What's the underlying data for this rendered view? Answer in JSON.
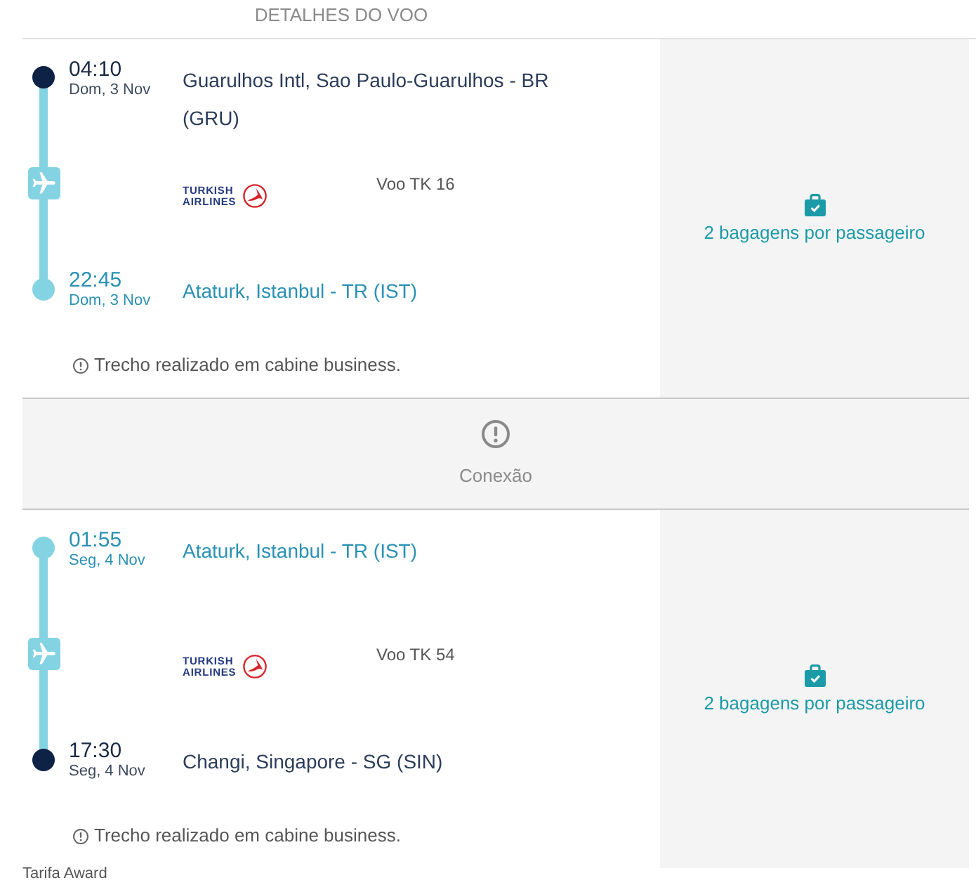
{
  "header": {
    "title": "DETALHES DO VOO"
  },
  "itinerary": [
    {
      "kind": "segment",
      "departure": {
        "time": "04:10",
        "date": "Dom, 3 Nov",
        "location": "Guarulhos Intl, Sao Paulo-Guarulhos - BR (GRU)",
        "highlighted": false
      },
      "airline_logo": "TURKISH AIRLINES",
      "flight": "Voo TK 16",
      "arrival": {
        "time": "22:45",
        "date": "Dom, 3 Nov",
        "location": "Ataturk, Istanbul - TR (IST)",
        "highlighted": true
      },
      "note": "Trecho realizado em cabine business.",
      "baggage": "2 bagagens por passageiro"
    },
    {
      "kind": "connection",
      "label": "Conexão"
    },
    {
      "kind": "segment",
      "departure": {
        "time": "01:55",
        "date": "Seg, 4 Nov",
        "location": "Ataturk, Istanbul - TR (IST)",
        "highlighted": true
      },
      "airline_logo": "TURKISH AIRLINES",
      "flight": "Voo TK 54",
      "arrival": {
        "time": "17:30",
        "date": "Seg, 4 Nov",
        "location": "Changi, Singapore - SG (SIN)",
        "highlighted": false
      },
      "note": "Trecho realizado em cabine business.",
      "baggage": "2 bagagens por passageiro"
    }
  ],
  "fare": "Tarifa Award"
}
